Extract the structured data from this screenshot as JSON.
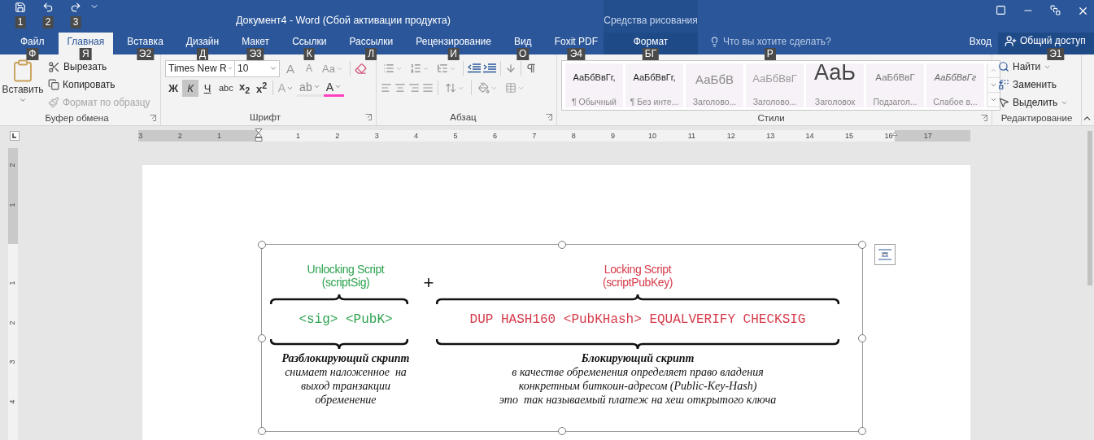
{
  "window": {
    "title": "Документ4 - Word (Сбой активации продукта)",
    "contextual_header": "Средства рисования"
  },
  "quick_access": [
    {
      "kind": "save",
      "keytip": "1"
    },
    {
      "kind": "undo",
      "keytip": "2"
    },
    {
      "kind": "redo",
      "keytip": "3"
    }
  ],
  "tabs": [
    {
      "label": "Файл",
      "keytip": "Ф",
      "selected": false
    },
    {
      "label": "Главная",
      "keytip": "Я",
      "selected": true
    },
    {
      "label": "Вставка",
      "keytip": "Э2",
      "selected": false
    },
    {
      "label": "Дизайн",
      "keytip": "Д",
      "selected": false
    },
    {
      "label": "Макет",
      "keytip": "Э3",
      "selected": false
    },
    {
      "label": "Ссылки",
      "keytip": "К",
      "selected": false
    },
    {
      "label": "Рассылки",
      "keytip": "Л",
      "selected": false
    },
    {
      "label": "Рецензирование",
      "keytip": "И",
      "selected": false
    },
    {
      "label": "Вид",
      "keytip": "О",
      "selected": false
    },
    {
      "label": "Foxit PDF",
      "keytip": "Э4",
      "selected": false
    }
  ],
  "contextual_tab": {
    "label": "Формат",
    "keytip": "БГ",
    "selected": false
  },
  "tell_me": {
    "placeholder": "Что вы хотите сделать?",
    "keytip": "Р"
  },
  "sign_in": "Вход",
  "share": {
    "label": "Общий доступ",
    "keytip": "Э1"
  },
  "clipboard": {
    "title": "Буфер обмена",
    "paste": "Вставить",
    "items": [
      {
        "kind": "cut",
        "label": "Вырезать",
        "disabled": false
      },
      {
        "kind": "copy",
        "label": "Копировать",
        "disabled": false
      },
      {
        "kind": "painter",
        "label": "Формат по образцу",
        "disabled": true
      }
    ]
  },
  "font": {
    "title": "Шрифт",
    "font_name": "Times New R",
    "font_size": "10",
    "row1": [
      {
        "kind": "grow",
        "label": "A"
      },
      {
        "kind": "shrink",
        "label": "A"
      },
      {
        "kind": "case",
        "label": "Aa"
      }
    ],
    "row2": [
      {
        "kind": "bold",
        "label": "Ж",
        "selected": false
      },
      {
        "kind": "italic",
        "label": "К",
        "selected": true
      },
      {
        "kind": "underline",
        "label": "Ч",
        "selected": false
      },
      {
        "kind": "strike",
        "label": "abc",
        "selected": false
      },
      {
        "kind": "sub",
        "label": "x$_{2}$",
        "selected": false
      },
      {
        "kind": "sup",
        "label": "x$^{2}$",
        "selected": false
      }
    ],
    "effects": [
      {
        "kind": "effects",
        "label": "A"
      },
      {
        "kind": "highlight",
        "label": "ab"
      },
      {
        "kind": "color",
        "label": "A"
      }
    ]
  },
  "paragraph": {
    "title": "Абзац"
  },
  "styles": {
    "title": "Стили",
    "items": [
      {
        "kind": "normal",
        "sample": "АаБбВвГг,",
        "name": "¶ Обычный"
      },
      {
        "kind": "normal",
        "sample": "АаБбВвГг,",
        "name": "¶ Без инте..."
      },
      {
        "kind": "heading1",
        "sample": "АаБбВ",
        "name": "Заголово..."
      },
      {
        "kind": "heading2",
        "sample": "АаБбВвГ",
        "name": "Заголово..."
      },
      {
        "kind": "title",
        "sample": "АаЬ",
        "name": "Заголовок"
      },
      {
        "kind": "subtitle",
        "sample": "АаБбВвГ",
        "name": "Подзагол..."
      },
      {
        "kind": "emphasis",
        "sample": "АаБбВвГг",
        "name": "Слабое в..."
      }
    ]
  },
  "editing": {
    "title": "Редактирование",
    "items": [
      {
        "kind": "find",
        "label": "Найти"
      },
      {
        "kind": "replace",
        "label": "Заменить"
      },
      {
        "kind": "select",
        "label": "Выделить"
      }
    ]
  },
  "ruler": {
    "left_numbers": [
      "3",
      "2",
      "1"
    ],
    "right_numbers": [
      "1",
      "2",
      "3",
      "4",
      "5",
      "6",
      "7",
      "8",
      "9",
      "10",
      "11",
      "12",
      "13",
      "14",
      "15",
      "16",
      "17"
    ]
  },
  "vertical_ruler": {
    "top_numbers": [
      "2",
      "1"
    ],
    "bottom_numbers": [
      "1",
      "2",
      "3",
      "4"
    ]
  },
  "figure": {
    "plus": "+",
    "parts": [
      {
        "title": "Unlocking Script",
        "subtitle": "(scriptSig)",
        "code": "<sig> <PubK>",
        "color": "#2da24f"
      },
      {
        "title": "Locking Script",
        "subtitle": "(scriptPubKey)",
        "code": "DUP HASH160 <PubKHash> EQUALVERIFY CHECKSIG",
        "color": "#d63a4a"
      }
    ],
    "captions": [
      {
        "title": "Разблокирующий скрипт",
        "lines": [
          "снимает наложенное  на",
          "выход транзакции",
          "обременение"
        ]
      },
      {
        "title": "Блокирующий скрипт",
        "lines": [
          "в качестве обременения определяет право владения",
          "конкретным биткоин-адресом (Public-Key-Hash)",
          "это  так называемый платеж на хеш открытого ключа"
        ]
      }
    ]
  }
}
